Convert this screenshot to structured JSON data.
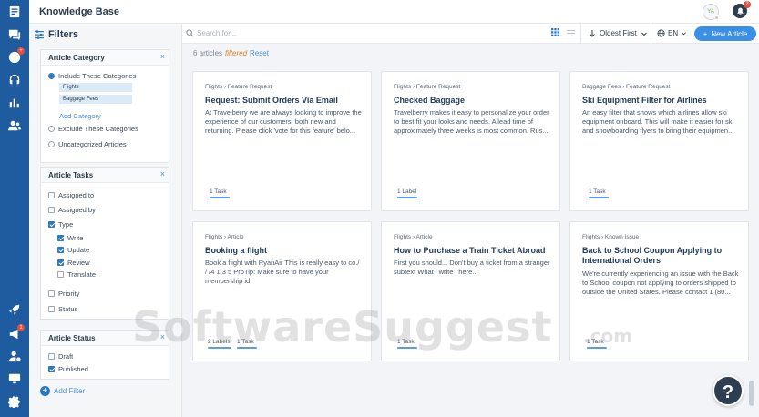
{
  "header": {
    "title": "Knowledge Base",
    "avatar_initials": "YA",
    "notification_count": "2"
  },
  "rail": {
    "items": [
      {
        "icon": "articles-icon"
      },
      {
        "icon": "chat-icon",
        "badge": "3"
      },
      {
        "icon": "email-icon",
        "badge": "+"
      },
      {
        "icon": "support-headset-icon"
      },
      {
        "icon": "reports-icon"
      },
      {
        "icon": "contacts-icon"
      },
      {
        "icon": "rocket-icon"
      },
      {
        "icon": "campaigns-icon",
        "badge": "1"
      },
      {
        "icon": "user-settings-icon"
      },
      {
        "icon": "monitor-icon"
      },
      {
        "icon": "settings-gear-icon"
      }
    ]
  },
  "filters": {
    "heading": "Filters",
    "category": {
      "title": "Article Category",
      "include_label": "Include These Categories",
      "tags": [
        "Flights",
        "Baggage Fees"
      ],
      "add_label": "Add Category",
      "exclude_label": "Exclude These Categories",
      "uncategorized_label": "Uncategorized Articles"
    },
    "tasks": {
      "title": "Article Tasks",
      "assigned_to": "Assigned to",
      "assigned_by": "Assigned by",
      "type": "Type",
      "write": "Write",
      "update": "Update",
      "review": "Review",
      "translate": "Translate",
      "priority": "Priority",
      "status": "Status"
    },
    "status": {
      "title": "Article Status",
      "draft": "Draft",
      "published": "Published"
    },
    "add_filter": "Add Filter",
    "close_glyph": "×"
  },
  "toolbar": {
    "search_placeholder": "Search for...",
    "sort_label": "Oldest First",
    "lang_label": "EN",
    "new_article": "New Article"
  },
  "summary": {
    "count": "6 articles",
    "filtered": "filtered",
    "reset": "Reset"
  },
  "articles": [
    {
      "crumb": "Flights › Feature Request",
      "title": "Request: Submit Orders Via Email",
      "body": "At Travelberry we are always looking to improve the experience of our customers, both new and returning. Please click 'vote for this feature' belo...",
      "meta": [
        "1 Task"
      ]
    },
    {
      "crumb": "Flights › Feature Request",
      "title": "Checked Baggage",
      "body": "Travelberry makes it easy to personalize your order to best fit your looks and needs. A lead time of approximately three weeks is most common. Rus...",
      "meta": [
        "1 Label"
      ]
    },
    {
      "crumb": "Baggage Fees › Feature Request",
      "title": "Ski Equipment Filter for Airlines",
      "body": "An easy filter that shows which airlines allow ski equipment onboard. This will make it easier for ski and snowboarding flyers to bring their equipmen...",
      "meta": [
        "1 Task"
      ]
    },
    {
      "crumb": "Flights › Article",
      "title": "Booking a flight",
      "body": "Book a flight with RyanAir This is really easy to co./ / /4 1 3 5 ProTip: Make sure to have your membership id",
      "meta": [
        "2 Labels",
        "1 Task"
      ]
    },
    {
      "crumb": "Flights › Article",
      "title": "How to Purchase a Train Ticket Abroad",
      "body": "First you should... Don't buy a ticket from a stranger subtext What i write i here...",
      "meta": [
        "1 Task"
      ]
    },
    {
      "crumb": "Flights › Known Issue",
      "title": "Back to School Coupon Applying to International Orders",
      "body": "We're currently experiencing an issue with the Back to School coupon not applying to orders shipped to outside the United States. Please contact 1 (80...",
      "meta": [
        "1 Task"
      ]
    }
  ],
  "help_glyph": "?",
  "watermark": {
    "main": "SoftwareSuggest",
    "suffix": ".com"
  }
}
